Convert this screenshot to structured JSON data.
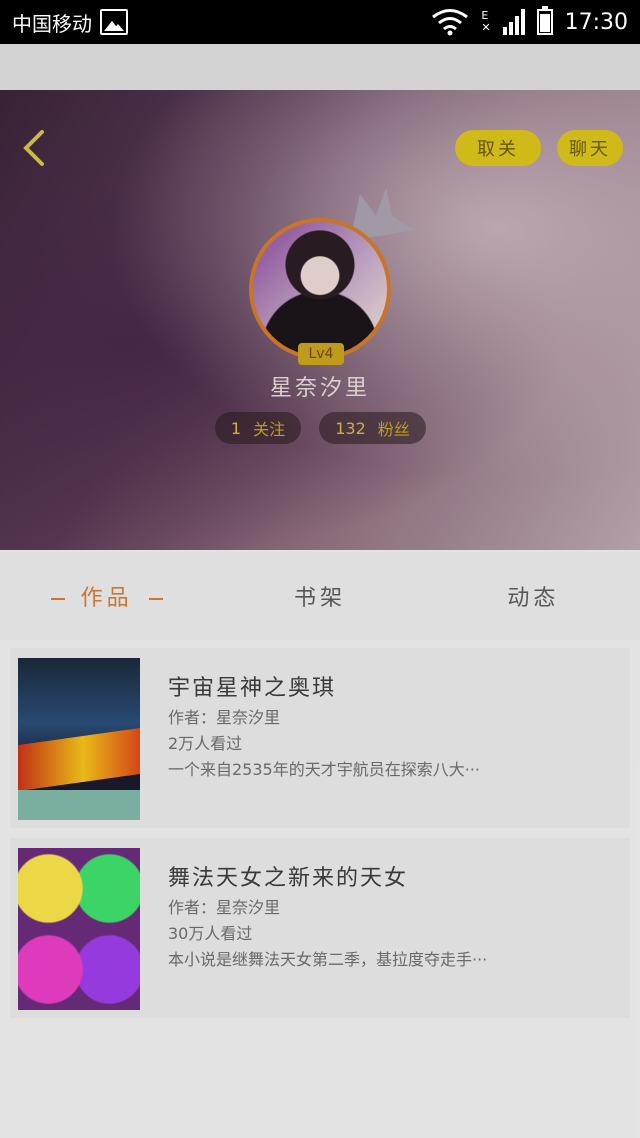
{
  "status_bar": {
    "carrier": "中国移动",
    "time": "17:30",
    "network_label": "E",
    "icons": [
      "image-icon",
      "wifi-icon",
      "signal-icon",
      "battery-icon"
    ]
  },
  "header": {
    "back_icon": "chevron-left-icon",
    "unfollow_label": "取关",
    "chat_label": "聊天"
  },
  "profile": {
    "level": "Lv4",
    "name": "星奈汐里",
    "following_count": "1",
    "following_label": "关注",
    "fans_count": "132",
    "fans_label": "粉丝"
  },
  "tabs": [
    {
      "label": "作品",
      "active": true
    },
    {
      "label": "书架",
      "active": false
    },
    {
      "label": "动态",
      "active": false
    }
  ],
  "works": [
    {
      "title": "宇宙星神之奥琪",
      "author": "作者：星奈汐里",
      "views": "2万人看过",
      "description": "一个来自2535年的天才宇航员在探索八大···"
    },
    {
      "title": "舞法天女之新来的天女",
      "author": "作者：星奈汐里",
      "views": "30万人看过",
      "description": "本小说是继舞法天女第二季，基拉度夺走手···"
    }
  ],
  "colors": {
    "accent_orange": "#cf7b3a",
    "button_yellow": "#d8c21c",
    "status_bar_bg": "#000000"
  }
}
